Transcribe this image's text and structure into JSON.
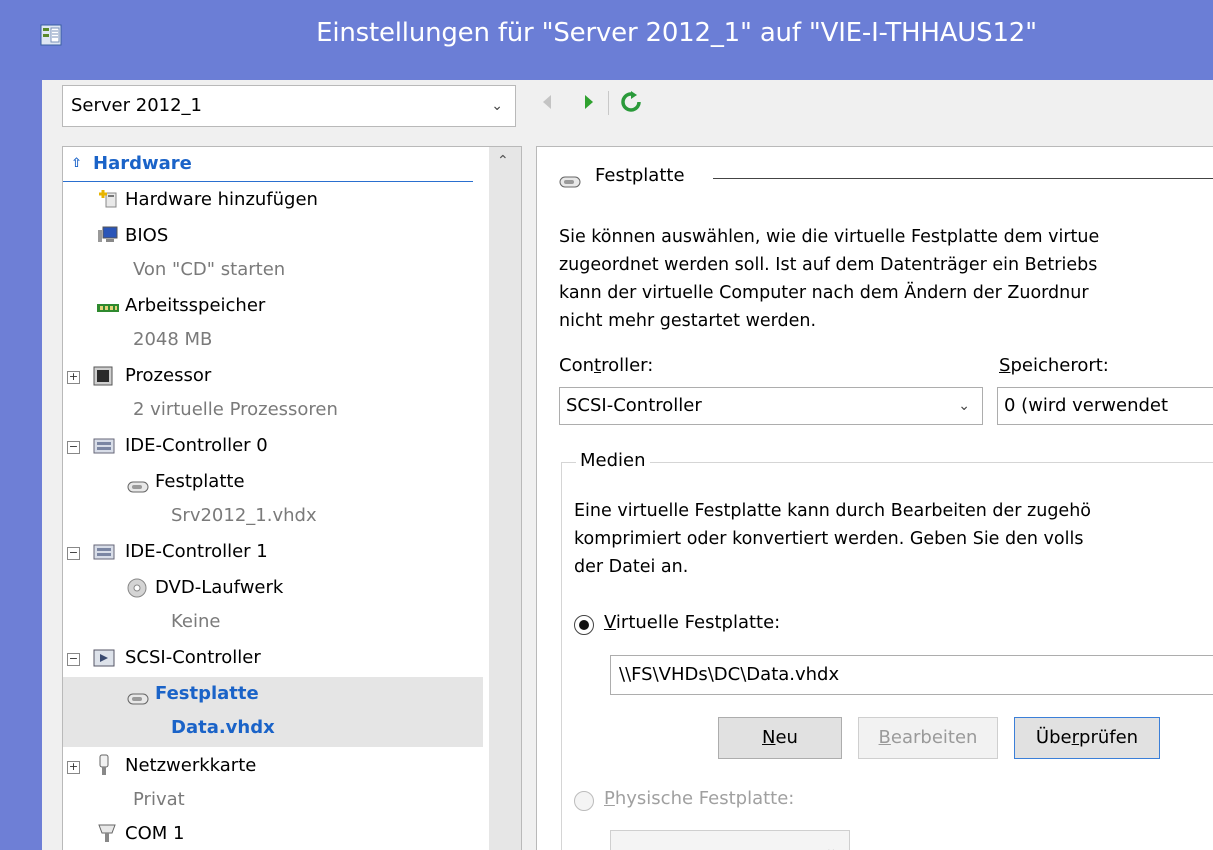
{
  "window": {
    "title": "Einstellungen für \"Server 2012_1\" auf \"VIE-I-THHAUS12\""
  },
  "toolbar": {
    "vm_selected": "Server 2012_1"
  },
  "tree": {
    "section": "Hardware",
    "items": [
      {
        "label": "Hardware hinzufügen"
      },
      {
        "label": "BIOS",
        "sub": "Von \"CD\" starten"
      },
      {
        "label": "Arbeitsspeicher",
        "sub": "2048 MB"
      },
      {
        "label": "Prozessor",
        "sub": "2 virtuelle Prozessoren"
      },
      {
        "label": "IDE-Controller 0"
      },
      {
        "label": "Festplatte",
        "sub": "Srv2012_1.vhdx"
      },
      {
        "label": "IDE-Controller 1"
      },
      {
        "label": "DVD-Laufwerk",
        "sub": "Keine"
      },
      {
        "label": "SCSI-Controller"
      },
      {
        "label": "Festplatte",
        "sub": "Data.vhdx"
      },
      {
        "label": "Netzwerkkarte",
        "sub": "Privat"
      },
      {
        "label": "COM 1"
      }
    ]
  },
  "detail": {
    "group_title": "Festplatte",
    "description": [
      "Sie können auswählen, wie die virtuelle Festplatte dem virtue",
      "zugeordnet werden soll. Ist auf dem Datenträger ein Betriebs",
      "kann der virtuelle Computer nach dem Ändern der Zuordnur",
      "nicht mehr gestartet werden."
    ],
    "controller_label_pre": "Con",
    "controller_label_u": "t",
    "controller_label_post": "roller:",
    "controller_value": "SCSI-Controller",
    "location_label_u": "S",
    "location_label_post": "peicherort:",
    "location_value": "0 (wird verwendet",
    "media": {
      "title": "Medien",
      "description": [
        "Eine virtuelle Festplatte kann durch Bearbeiten der zugehö",
        "komprimiert oder konvertiert werden. Geben Sie den volls",
        "der Datei an."
      ],
      "virtual_u": "V",
      "virtual_post": "irtuelle Festplatte:",
      "virtual_path": "\\\\FS\\VHDs\\DC\\Data.vhdx",
      "btn_new_u": "N",
      "btn_new_post": "eu",
      "btn_edit_u": "B",
      "btn_edit_post": "earbeiten",
      "btn_check_pre": "Übe",
      "btn_check_u": "r",
      "btn_check_post": "prüfen",
      "physical_u": "P",
      "physical_post": "hysische Festplatte:",
      "physical_value": ""
    }
  },
  "colors": {
    "titlebar": "#6b7ed6",
    "accent": "#1a63c8"
  }
}
